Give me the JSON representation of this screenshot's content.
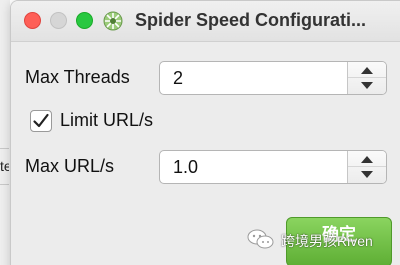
{
  "window": {
    "title": "Spider Speed Configurati...",
    "traffic_lights": [
      "close",
      "minimize",
      "maximize"
    ],
    "app_icon": "spider-app-icon"
  },
  "form": {
    "max_threads": {
      "label": "Max Threads",
      "value": "2"
    },
    "limit_urls": {
      "label": "Limit URL/s",
      "checked": true
    },
    "max_urls": {
      "label": "Max URL/s",
      "value": "1.0"
    }
  },
  "buttons": {
    "ok_label": "确定"
  },
  "background": {
    "fragment_text": "te"
  },
  "watermark": {
    "text": "跨境男孩Riven",
    "icon": "wechat-icon"
  },
  "colors": {
    "close": "#fe5f57",
    "minimize": "#d6d6d6",
    "maximize": "#28c840",
    "ok_button": "#6cc040"
  }
}
